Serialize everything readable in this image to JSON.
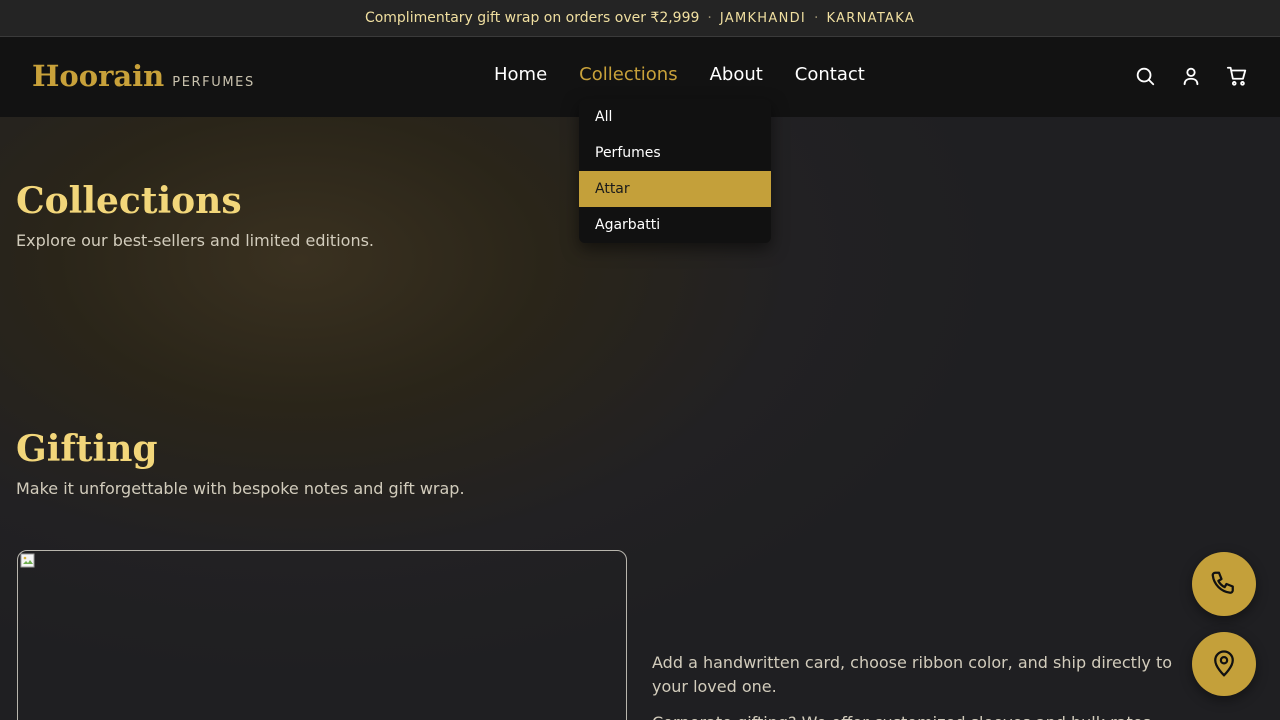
{
  "announcement": {
    "text": "Complimentary gift wrap on orders over ₹2,999",
    "city": "JAMKHANDI",
    "state": "KARNATAKA",
    "separator": "·"
  },
  "brand": {
    "name": "Hoorain",
    "tagline": "PERFUMES"
  },
  "nav": {
    "items": [
      {
        "label": "Home",
        "active": false
      },
      {
        "label": "Collections",
        "active": true
      },
      {
        "label": "About",
        "active": false
      },
      {
        "label": "Contact",
        "active": false
      }
    ]
  },
  "header_icons": [
    "search-icon",
    "account-icon",
    "cart-icon"
  ],
  "collections_menu": {
    "items": [
      {
        "label": "All"
      },
      {
        "label": "Perfumes"
      },
      {
        "label": "Attar",
        "highlighted": true
      },
      {
        "label": "Agarbatti"
      }
    ]
  },
  "collections": {
    "title": "Collections",
    "subtitle": "Explore our best-sellers and limited editions."
  },
  "gifting": {
    "title": "Gifting",
    "subtitle": "Make it unforgettable with bespoke notes and gift wrap.",
    "paragraph1": "Add a handwritten card, choose ribbon color, and ship directly to your loved one.",
    "paragraph2": "Corporate gifting? We offer customized sleeves and bulk rates."
  },
  "floating_actions": [
    "phone-icon",
    "location-pin-icon"
  ],
  "colors": {
    "accent": "#c4a03a",
    "heading": "#f2d67a",
    "header_bg": "#121212",
    "announcement_text": "#f0dfa0"
  }
}
